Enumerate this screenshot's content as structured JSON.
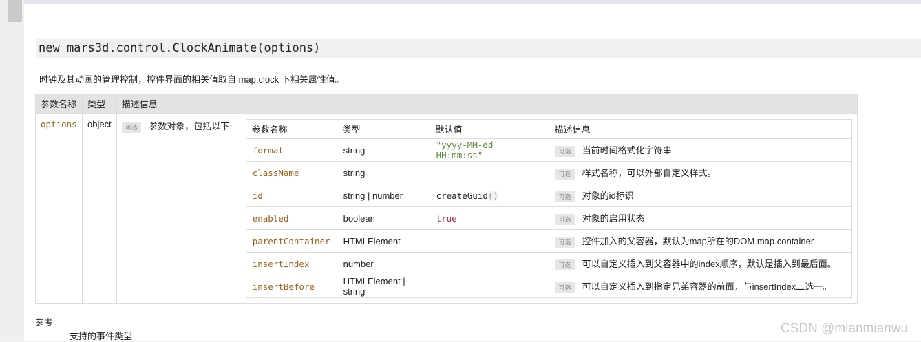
{
  "signature": "new mars3d.control.ClockAnimate(options)",
  "description": "时钟及其动画的管理控制，控件界面的相关值取自 map.clock 下相关属性值。",
  "outer_headers": [
    "参数名称",
    "类型",
    "描述信息"
  ],
  "param": {
    "name": "options",
    "type": "object",
    "badge": "可选",
    "desc": "参数对象，包括以下:"
  },
  "inner_headers": [
    "参数名称",
    "类型",
    "默认值",
    "描述信息"
  ],
  "rows": [
    {
      "name": "format",
      "type": "string",
      "default": "\"yyyy-MM-dd HH:mm:ss\"",
      "badge": "可选",
      "desc": "当前时间格式化字符串"
    },
    {
      "name": "className",
      "type": "string",
      "default": "",
      "badge": "可选",
      "desc": "样式名称，可以外部自定义样式。"
    },
    {
      "name": "id",
      "type": "string | number",
      "default": "createGuid",
      "default_suffix": "()",
      "badge": "可选",
      "desc": "对象的id标识"
    },
    {
      "name": "enabled",
      "type": "boolean",
      "default": "true",
      "badge": "可选",
      "desc": "对象的启用状态"
    },
    {
      "name": "parentContainer",
      "type": "HTMLElement",
      "default": "",
      "badge": "可选",
      "desc": "控件加入的父容器，默认为map所在的DOM map.container"
    },
    {
      "name": "insertIndex",
      "type": "number",
      "default": "",
      "badge": "可选",
      "desc": "可以自定义插入到父容器中的index顺序，默认是插入到最后面。"
    },
    {
      "name": "insertBefore",
      "type": "HTMLElement | string",
      "default": "",
      "badge": "可选",
      "desc": "可以自定义插入到指定兄弟容器的前面，与insertIndex二选一。"
    }
  ],
  "reference_label": "参考:",
  "reference_link": "支持的事件类型",
  "watermark": "CSDN @mianmianwu"
}
